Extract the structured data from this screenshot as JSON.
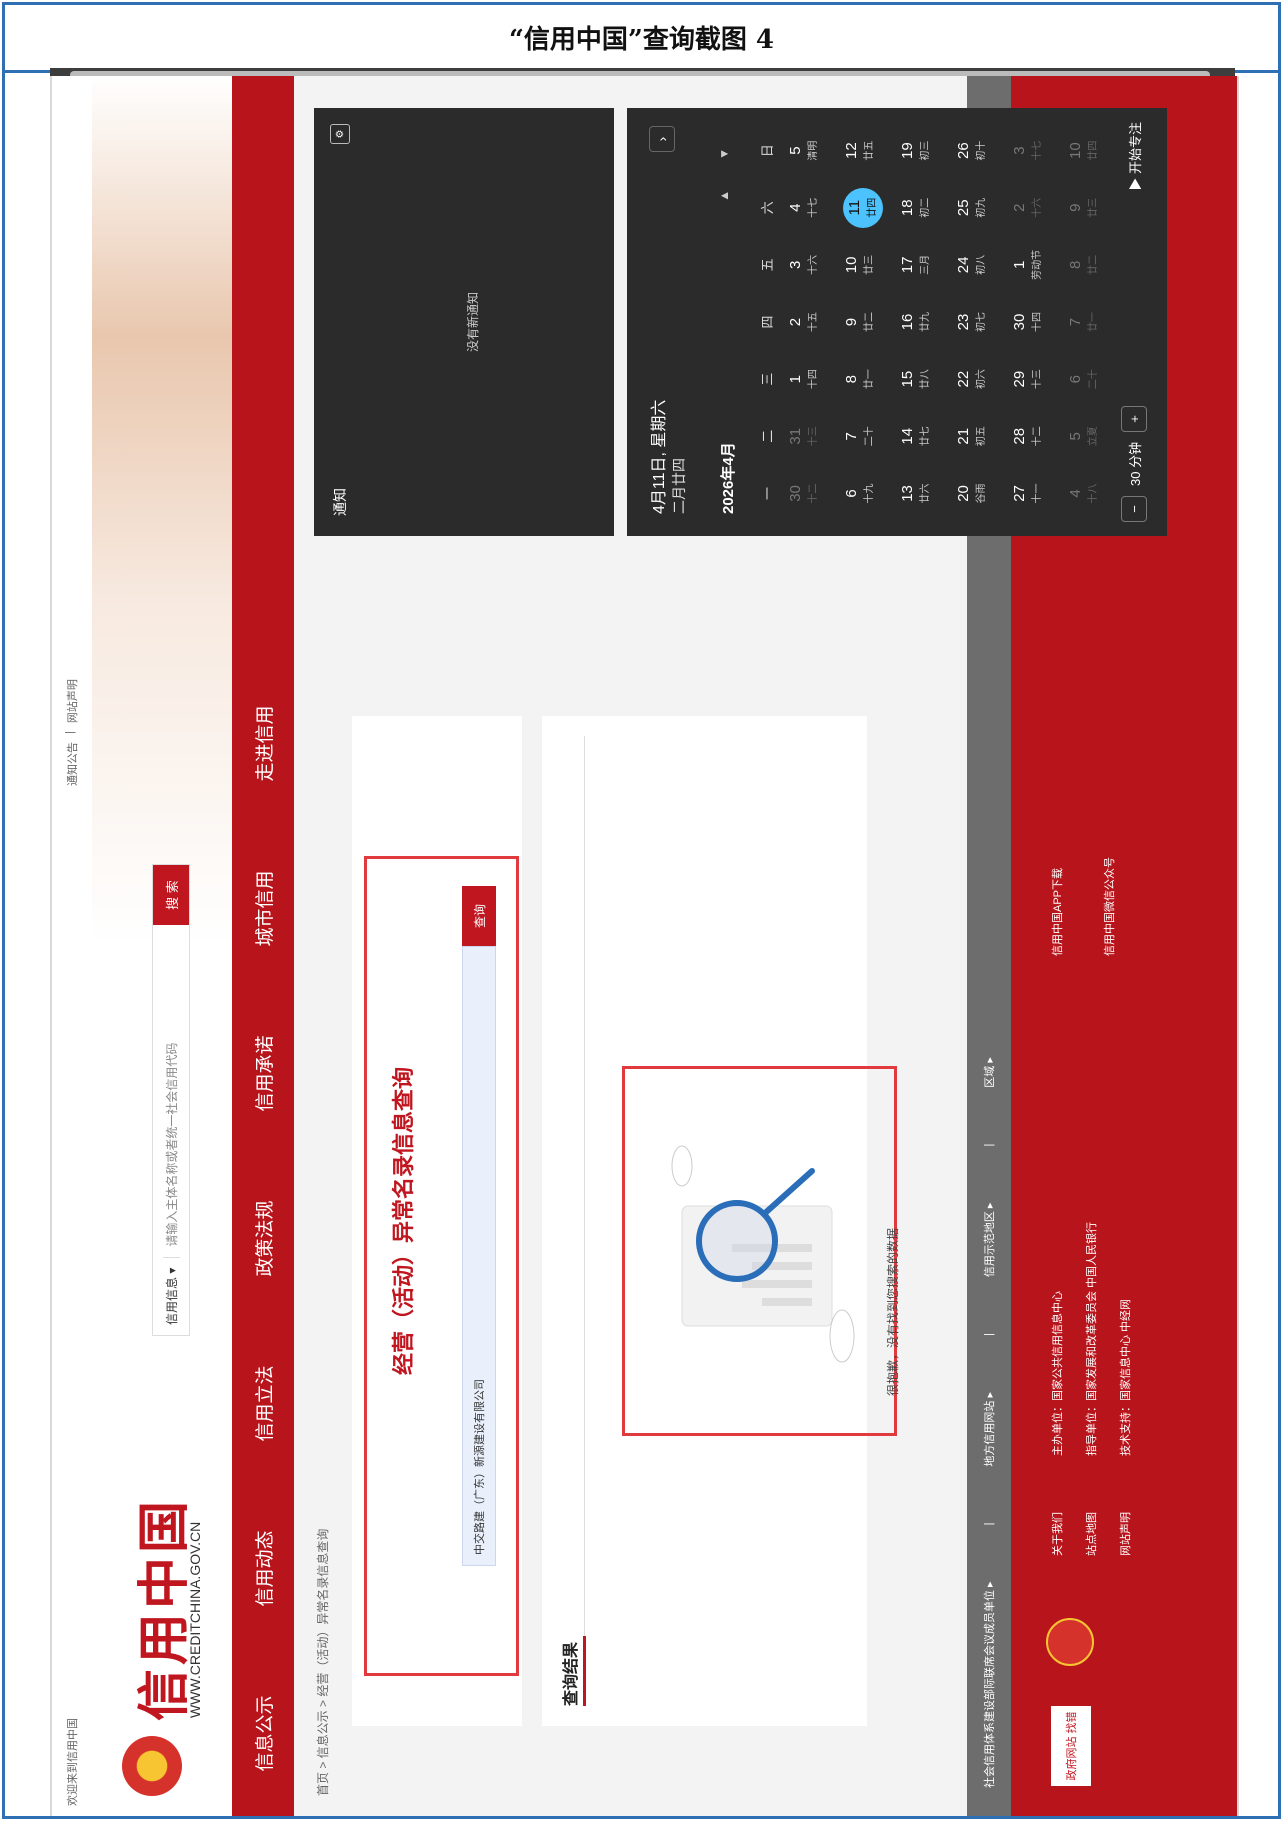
{
  "caption": "“信用中国”查询截图 4",
  "site": {
    "welcome": "欢迎来到信用中国",
    "top_links": [
      "通知公告",
      "|",
      "网站声明"
    ],
    "brand": "信用中国",
    "brand_sub": "WWW.CREDITCHINA.GOV.CN",
    "search_select": "信用信息 ▾",
    "search_placeholder": "请输入主体名称或者统一社会信用代码",
    "search_button": "搜 索"
  },
  "nav": [
    "信息公示",
    "信用动态",
    "信用立法",
    "政策法规",
    "信用承诺",
    "城市信用",
    "走进信用"
  ],
  "breadcrumb": "首页 > 信息公示 > 经营（活动）异常名录信息查询",
  "query": {
    "title": "经营（活动）异常名录信息查询",
    "input_value": "中交路建（广东）新源建设有限公司",
    "button": "查询"
  },
  "results": {
    "title": "查询结果",
    "empty_text": "很抱歉，没有找到您搜索的数据"
  },
  "footer_bar": [
    "社会信用体系建设部际联席会议成员单位 ▸",
    "|",
    "地方信用网站 ▸",
    "|",
    "信用示范地区 ▸",
    "|",
    "区域 ▸"
  ],
  "footer": {
    "links": [
      "关于我们",
      "站点地图",
      "网站声明"
    ],
    "host": "主办单位：国家公共信用信息中心",
    "guide": "指导单位：国家发展和改革委员会 中国人民银行",
    "tech": "技术支持：国家信息中心 中经网",
    "app": "信用中国APP下载",
    "wechat": "信用中国微信公众号",
    "gov_badge": "政府网站 找错"
  },
  "notification": {
    "title": "通知",
    "empty": "没有新通知"
  },
  "calendar": {
    "date": "4月11日, 星期六",
    "lunar": "二月廿四",
    "month": "2026年4月",
    "weekdays": [
      "一",
      "二",
      "三",
      "四",
      "五",
      "六",
      "日"
    ],
    "days": [
      {
        "d": "30",
        "l": "十二",
        "dim": true
      },
      {
        "d": "31",
        "l": "十三",
        "dim": true
      },
      {
        "d": "1",
        "l": "十四"
      },
      {
        "d": "2",
        "l": "十五"
      },
      {
        "d": "3",
        "l": "十六"
      },
      {
        "d": "4",
        "l": "十七"
      },
      {
        "d": "5",
        "l": "清明"
      },
      {
        "d": "6",
        "l": "十九"
      },
      {
        "d": "7",
        "l": "二十"
      },
      {
        "d": "8",
        "l": "廿一"
      },
      {
        "d": "9",
        "l": "廿二"
      },
      {
        "d": "10",
        "l": "廿三"
      },
      {
        "d": "11",
        "l": "廿四",
        "today": true
      },
      {
        "d": "12",
        "l": "廿五"
      },
      {
        "d": "13",
        "l": "廿六"
      },
      {
        "d": "14",
        "l": "廿七"
      },
      {
        "d": "15",
        "l": "廿八"
      },
      {
        "d": "16",
        "l": "廿九"
      },
      {
        "d": "17",
        "l": "三月"
      },
      {
        "d": "18",
        "l": "初二"
      },
      {
        "d": "19",
        "l": "初三"
      },
      {
        "d": "20",
        "l": "谷雨"
      },
      {
        "d": "21",
        "l": "初五"
      },
      {
        "d": "22",
        "l": "初六"
      },
      {
        "d": "23",
        "l": "初七"
      },
      {
        "d": "24",
        "l": "初八"
      },
      {
        "d": "25",
        "l": "初九"
      },
      {
        "d": "26",
        "l": "初十"
      },
      {
        "d": "27",
        "l": "十一"
      },
      {
        "d": "28",
        "l": "十二"
      },
      {
        "d": "29",
        "l": "十三"
      },
      {
        "d": "30",
        "l": "十四"
      },
      {
        "d": "1",
        "l": "劳动节"
      },
      {
        "d": "2",
        "l": "十六",
        "dim": true
      },
      {
        "d": "3",
        "l": "十七",
        "dim": true
      },
      {
        "d": "4",
        "l": "十八",
        "dim": true
      },
      {
        "d": "5",
        "l": "立夏",
        "dim": true
      },
      {
        "d": "6",
        "l": "二十",
        "dim": true
      },
      {
        "d": "7",
        "l": "廿一",
        "dim": true
      },
      {
        "d": "8",
        "l": "廿二",
        "dim": true
      },
      {
        "d": "9",
        "l": "廿三",
        "dim": true
      },
      {
        "d": "10",
        "l": "廿四",
        "dim": true
      }
    ],
    "focus_minutes": "30 分钟",
    "focus_button": "▶ 开始专注"
  }
}
